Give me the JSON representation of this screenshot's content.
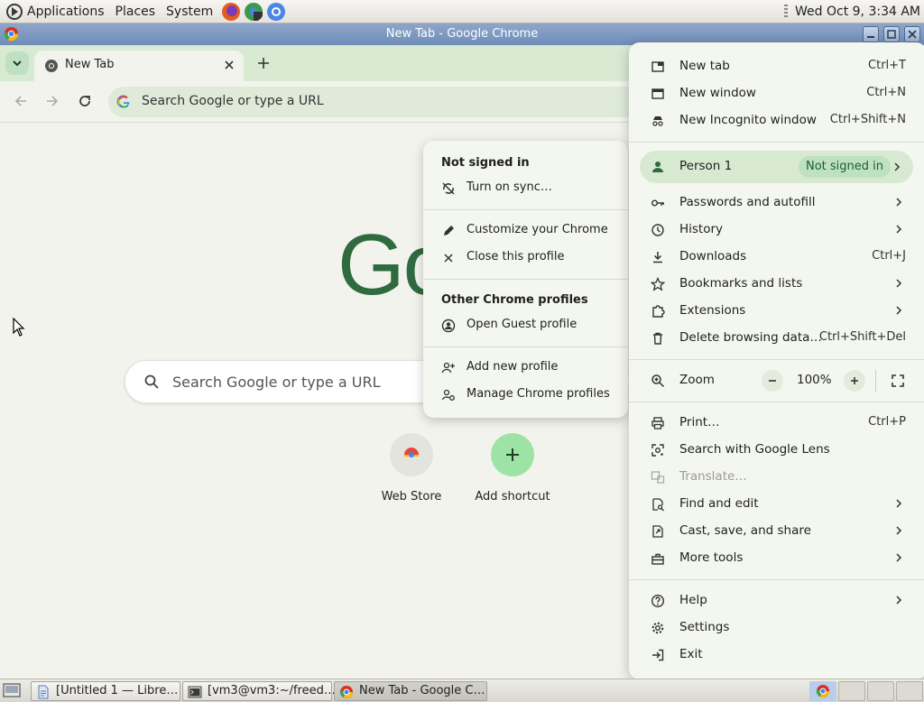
{
  "top_panel": {
    "menus": [
      "Applications",
      "Places",
      "System"
    ],
    "clock": "Wed Oct  9,  3:34 AM"
  },
  "window": {
    "title": "New Tab - Google Chrome"
  },
  "tabs": [
    {
      "title": "New Tab",
      "active": true
    }
  ],
  "toolbar": {
    "omnibox_placeholder": "Search Google or type a URL"
  },
  "ntp": {
    "logo_text": "Go",
    "search_placeholder": "Search Google or type a URL",
    "shortcuts": [
      {
        "label": "Web Store",
        "icon": "chrome-web-store-icon"
      },
      {
        "label": "Add shortcut",
        "icon": "plus-icon"
      }
    ]
  },
  "profile_menu": {
    "header": "Not signed in",
    "turn_on_sync": "Turn on sync…",
    "customize": "Customize your Chrome",
    "close_profile": "Close this profile",
    "other_profiles_header": "Other Chrome profiles",
    "open_guest": "Open Guest profile",
    "add_profile": "Add new profile",
    "manage_profiles": "Manage Chrome profiles"
  },
  "chrome_menu": {
    "new_tab": {
      "label": "New tab",
      "shortcut": "Ctrl+T"
    },
    "new_window": {
      "label": "New window",
      "shortcut": "Ctrl+N"
    },
    "new_incognito": {
      "label": "New Incognito window",
      "shortcut": "Ctrl+Shift+N"
    },
    "person": {
      "label": "Person 1",
      "badge": "Not signed in"
    },
    "passwords": {
      "label": "Passwords and autofill"
    },
    "history": {
      "label": "History"
    },
    "downloads": {
      "label": "Downloads",
      "shortcut": "Ctrl+J"
    },
    "bookmarks": {
      "label": "Bookmarks and lists"
    },
    "extensions": {
      "label": "Extensions"
    },
    "delete_data": {
      "label": "Delete browsing data…",
      "shortcut": "Ctrl+Shift+Del"
    },
    "zoom": {
      "label": "Zoom",
      "value": "100%"
    },
    "print": {
      "label": "Print…",
      "shortcut": "Ctrl+P"
    },
    "lens": {
      "label": "Search with Google Lens"
    },
    "translate": {
      "label": "Translate…",
      "disabled": true
    },
    "find_edit": {
      "label": "Find and edit"
    },
    "cast_save": {
      "label": "Cast, save, and share"
    },
    "more_tools": {
      "label": "More tools"
    },
    "help": {
      "label": "Help"
    },
    "settings": {
      "label": "Settings"
    },
    "exit": {
      "label": "Exit"
    }
  },
  "taskbar": {
    "items": [
      {
        "label": "[Untitled 1 — Libre…",
        "icon": "document-icon",
        "active": false
      },
      {
        "label": "[vm3@vm3:~/freed…",
        "icon": "terminal-icon",
        "active": false
      },
      {
        "label": "New Tab - Google C…",
        "icon": "chrome-icon",
        "active": true
      }
    ]
  },
  "colors": {
    "accent": "#2f6b3f",
    "menu_bg": "#f4f7ef",
    "tabstrip_bg": "#d9ead3",
    "badge_bg": "#bfe1c3",
    "titlebar": "#7f99c1"
  }
}
